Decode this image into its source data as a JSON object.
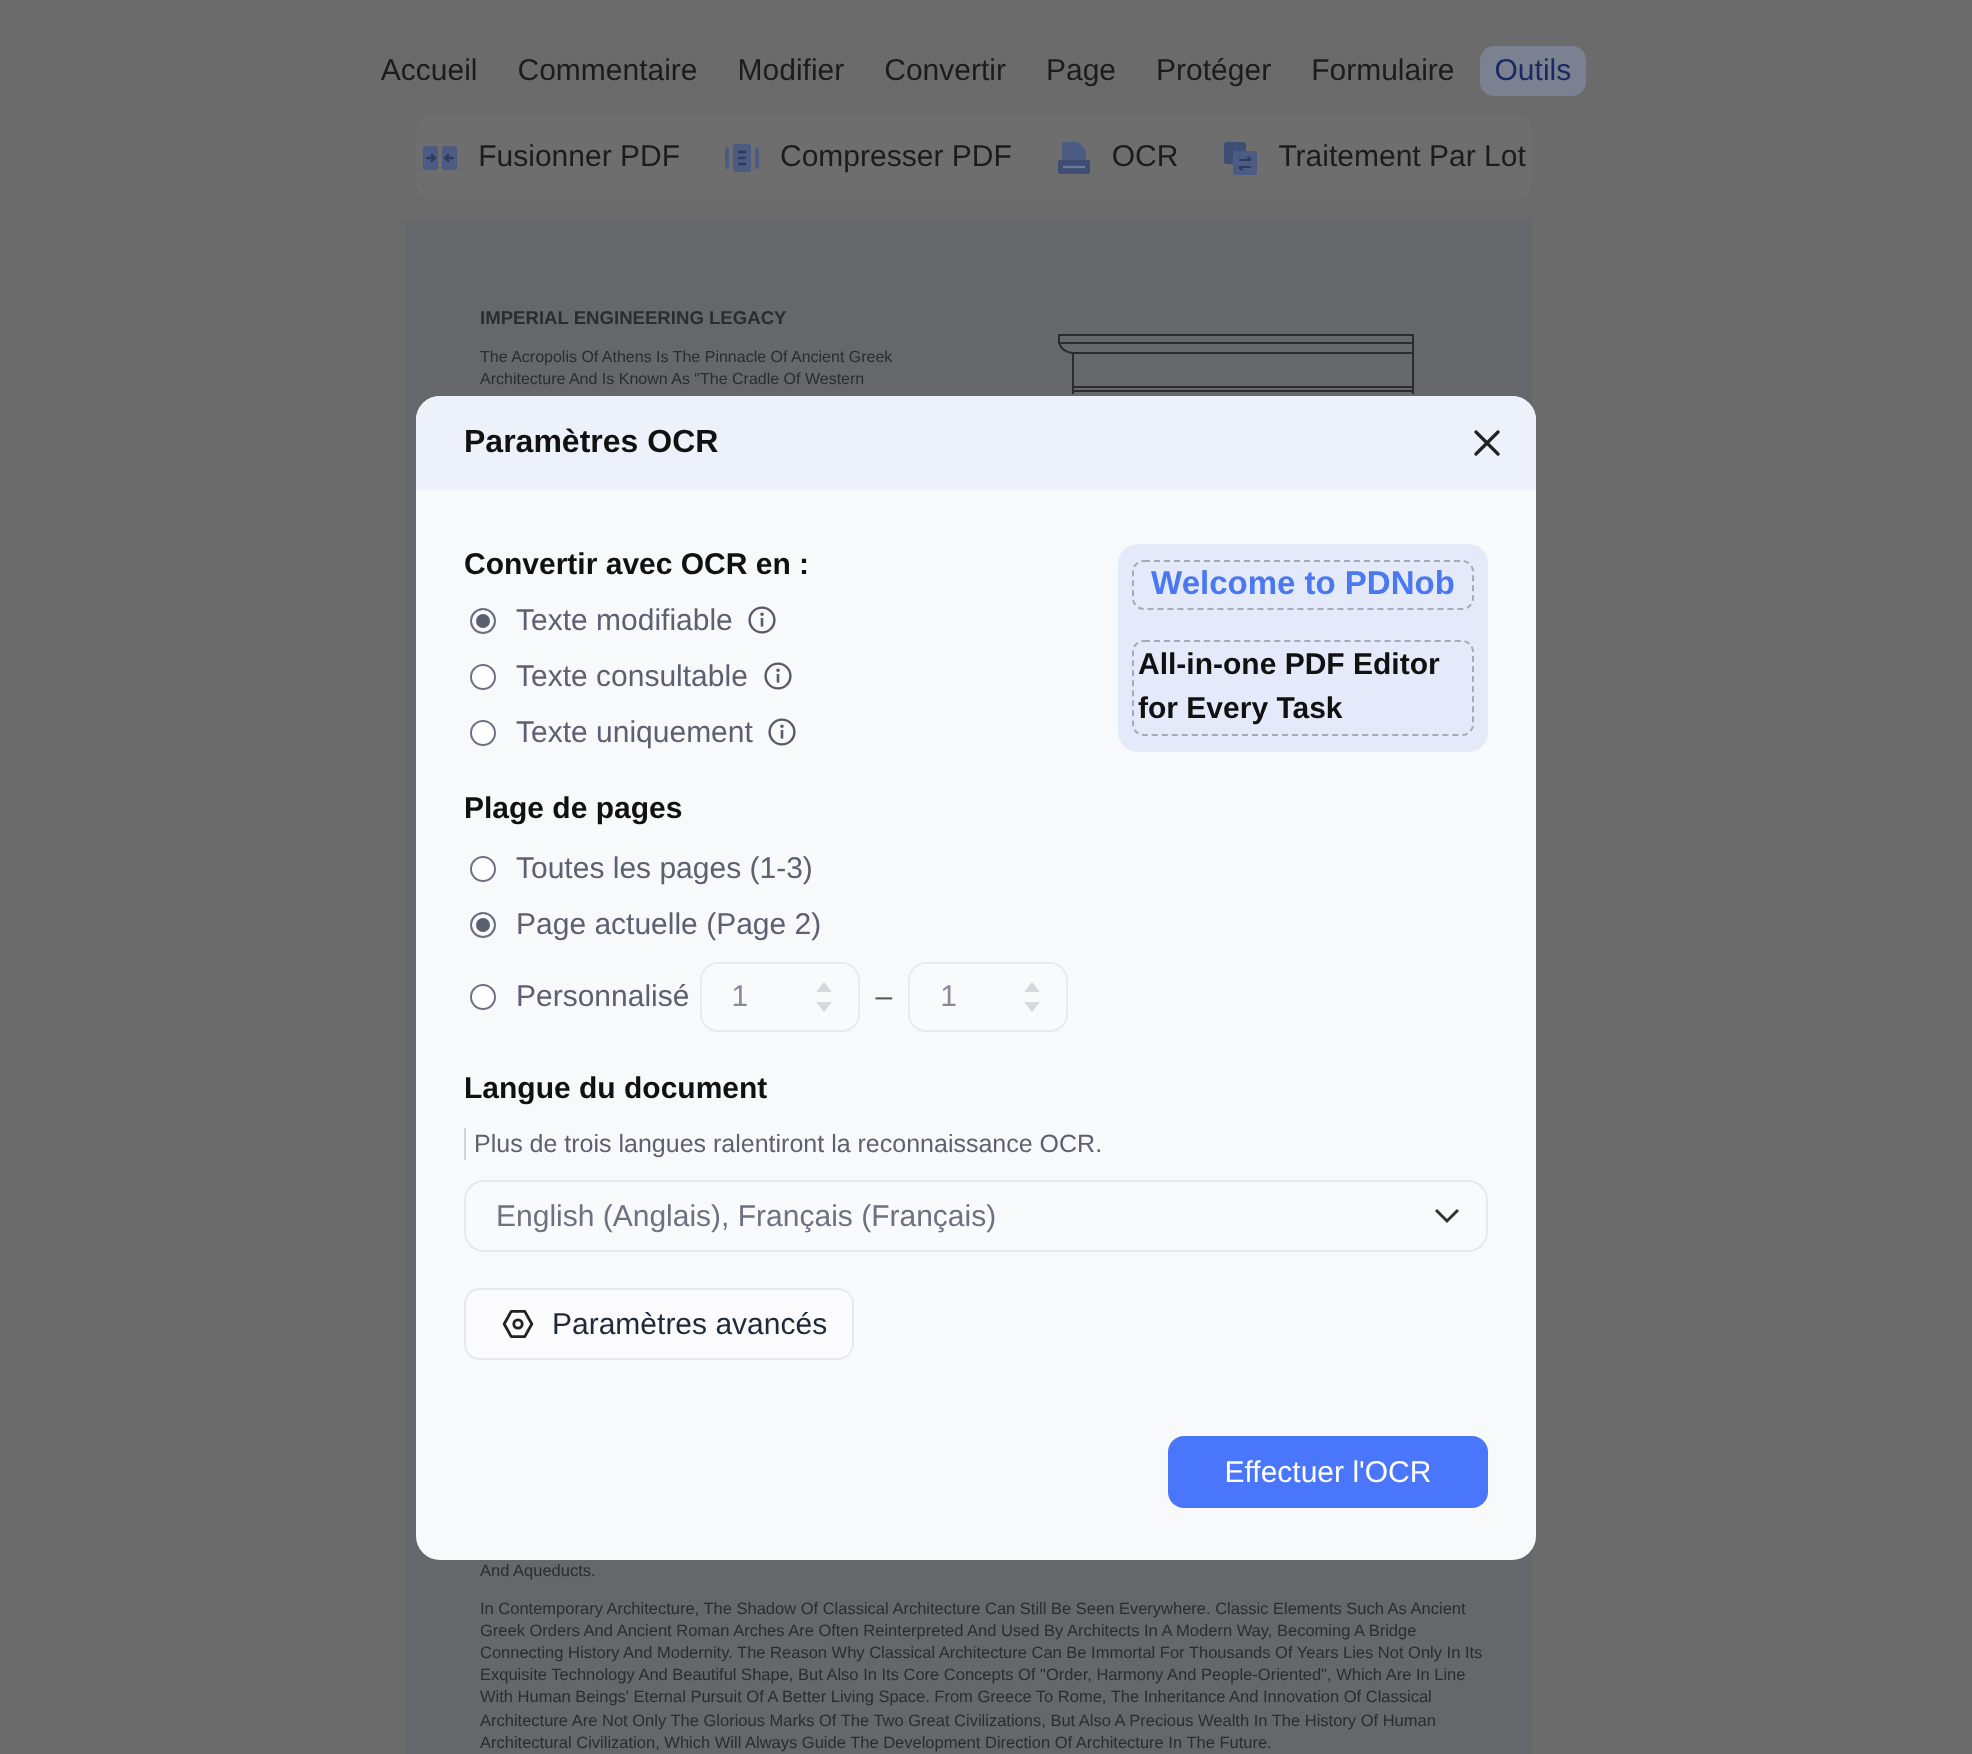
{
  "menu": {
    "tabs": [
      {
        "label": "Accueil",
        "selected": false
      },
      {
        "label": "Commentaire",
        "selected": false
      },
      {
        "label": "Modifier",
        "selected": false
      },
      {
        "label": "Convertir",
        "selected": false
      },
      {
        "label": "Page",
        "selected": false
      },
      {
        "label": "Protéger",
        "selected": false
      },
      {
        "label": "Formulaire",
        "selected": false
      },
      {
        "label": "Outils",
        "selected": true
      }
    ]
  },
  "toolbar": {
    "items": [
      {
        "kind": "merge",
        "label": "Fusionner PDF"
      },
      {
        "kind": "compress",
        "label": "Compresser PDF"
      },
      {
        "kind": "ocr",
        "label": "OCR"
      },
      {
        "kind": "batch",
        "label": "Traitement Par Lot"
      }
    ]
  },
  "document": {
    "title": "IMPERIAL ENGINEERING LEGACY",
    "intro_lines": [
      "The Acropolis Of Athens Is The Pinnacle Of Ancient Greek",
      "Architecture And Is Known As \"The Cradle Of Western"
    ],
    "closing_line": "And Aqueducts.",
    "paragraph_lines": [
      "In Contemporary Architecture, The Shadow Of Classical Architecture Can Still Be Seen Everywhere. Classic Elements Such As Ancient",
      "Greek Orders And Ancient Roman Arches Are Often Reinterpreted And Used By Architects In A Modern Way, Becoming A Bridge",
      "Connecting History And Modernity. The Reason Why Classical Architecture Can Be Immortal For Thousands Of Years Lies Not Only In Its",
      "Exquisite Technology And Beautiful Shape, But Also In Its Core Concepts Of \"Order, Harmony And People-Oriented\", Which Are In Line",
      "With Human Beings' Eternal Pursuit Of A Better Living Space. From Greece To Rome, The Inheritance And Innovation Of Classical",
      "Architecture Are Not Only The Glorious Marks Of The Two Great Civilizations, But Also A Precious Wealth In The History Of Human",
      "Architectural Civilization, Which Will Always Guide The Development Direction Of Architecture In The Future."
    ]
  },
  "dialog": {
    "title": "Paramètres OCR",
    "convert": {
      "heading": "Convertir avec OCR en :",
      "options": [
        {
          "kind": "plain",
          "label": "Texte modifiable",
          "selected": true,
          "info": true
        },
        {
          "kind": "plain",
          "label": "Texte consultable",
          "selected": false,
          "info": true
        },
        {
          "kind": "plain",
          "label": "Texte uniquement",
          "selected": false,
          "info": true
        }
      ]
    },
    "promo": {
      "headline": "Welcome to PDNob",
      "tagline_lines": [
        "All-in-one PDF Editor",
        "for Every Task"
      ]
    },
    "page_range": {
      "heading": "Plage de pages",
      "options": [
        {
          "kind": "plain",
          "label": "Toutes les pages (1-3)",
          "selected": false
        },
        {
          "kind": "plain",
          "label": "Page actuelle (Page 2)",
          "selected": true
        },
        {
          "kind": "range",
          "label": "Personnalisé",
          "selected": false,
          "range": {
            "from": "1",
            "to": "1",
            "separator": "–",
            "disabled": true
          }
        }
      ]
    },
    "language": {
      "heading": "Langue du document",
      "hint": "Plus de trois langues ralentiront la reconnaissance OCR.",
      "value": "English (Anglais), Français (Français)"
    },
    "advanced_button": "Paramètres avancés",
    "submit_button": "Effectuer l'OCR"
  }
}
